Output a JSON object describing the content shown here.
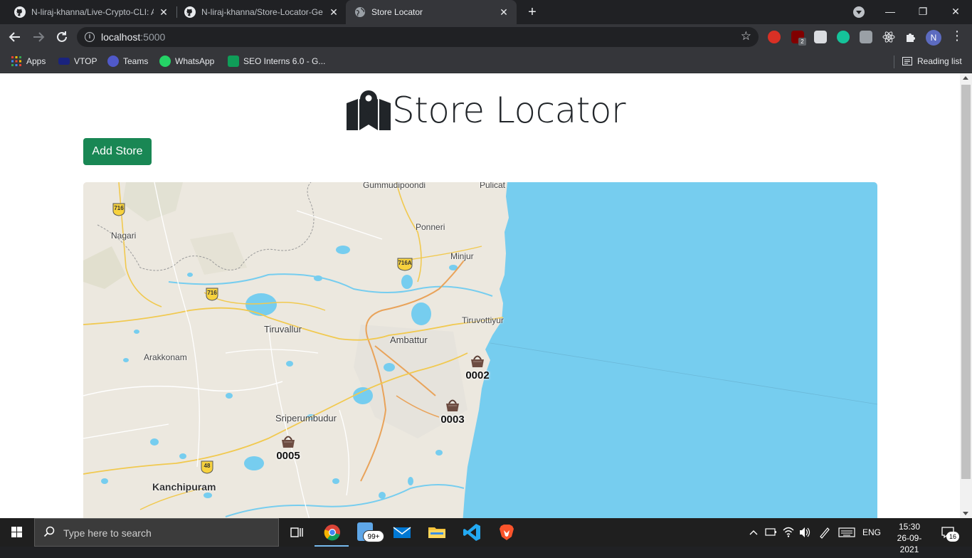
{
  "browser": {
    "tabs": [
      {
        "title": "N-liraj-khanna/Live-Crypto-CLI: A",
        "active": false,
        "icon": "github-icon"
      },
      {
        "title": "N-liraj-khanna/Store-Locator-Ge",
        "active": false,
        "icon": "github-icon"
      },
      {
        "title": "Store Locator",
        "active": true,
        "icon": "globe-icon"
      }
    ],
    "close_glyph": "✕",
    "new_tab_glyph": "+",
    "window_controls": {
      "minimize": "—",
      "restore": "❐",
      "close": "✕"
    },
    "address": {
      "host": "localhost",
      "port": ":5000"
    },
    "profile_initial": "N",
    "extension_badge": "2",
    "bookmarks": [
      {
        "label": "Apps",
        "color": "#ea4335"
      },
      {
        "label": "VTOP",
        "color": "#1a237e"
      },
      {
        "label": "Teams",
        "color": "#5059c9"
      },
      {
        "label": "WhatsApp",
        "color": "#25d366"
      },
      {
        "label": "SEO Interns 6.0 - G...",
        "color": "#0f9d58"
      }
    ],
    "reading_list": "Reading list"
  },
  "page": {
    "title": "Store Locator",
    "add_store_button": "Add Store",
    "accent_color": "#198754"
  },
  "map": {
    "places": [
      {
        "name": "Gummudipoondi",
        "size": "small"
      },
      {
        "name": "Pulicat",
        "size": "small"
      },
      {
        "name": "Nagari",
        "size": "small"
      },
      {
        "name": "Ponneri",
        "size": "small"
      },
      {
        "name": "Minjur",
        "size": "small"
      },
      {
        "name": "Tiruvottiyur",
        "size": "small"
      },
      {
        "name": "Tiruvallur",
        "size": "mid"
      },
      {
        "name": "Ambattur",
        "size": "mid"
      },
      {
        "name": "Arakkonam",
        "size": "small"
      },
      {
        "name": "Sriperumbudur",
        "size": "mid"
      },
      {
        "name": "Kanchipuram",
        "size": "big"
      }
    ],
    "highway_shields": [
      "716",
      "716A",
      "716",
      "48"
    ],
    "store_markers": [
      "0002",
      "0003",
      "0005"
    ],
    "water_color": "#76cdef",
    "land_color": "#ece8df"
  },
  "taskbar": {
    "search_placeholder": "Type here to search",
    "mail_badge": "99+",
    "language": "ENG",
    "time": "15:30",
    "date": "26-09-2021",
    "notification_count": "16"
  }
}
